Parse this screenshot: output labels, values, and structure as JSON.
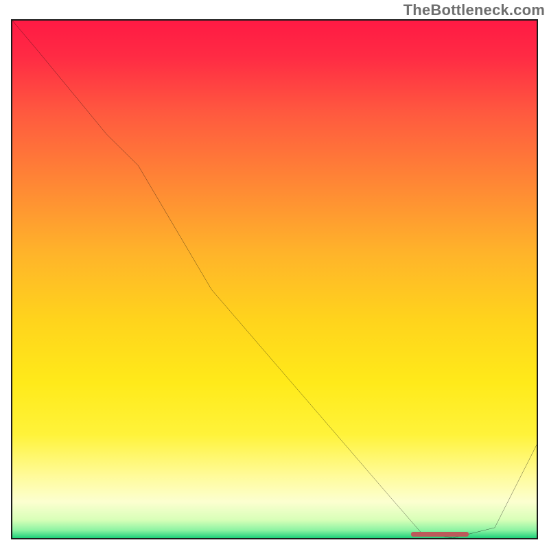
{
  "watermark": "TheBottleneck.com",
  "gradient_stops": [
    {
      "offset": 0.0,
      "color": "#ff1a44"
    },
    {
      "offset": 0.07,
      "color": "#ff2b44"
    },
    {
      "offset": 0.18,
      "color": "#ff5a3f"
    },
    {
      "offset": 0.3,
      "color": "#ff8236"
    },
    {
      "offset": 0.45,
      "color": "#ffb42a"
    },
    {
      "offset": 0.58,
      "color": "#ffd41c"
    },
    {
      "offset": 0.7,
      "color": "#ffea1a"
    },
    {
      "offset": 0.8,
      "color": "#fff33a"
    },
    {
      "offset": 0.88,
      "color": "#fffb9a"
    },
    {
      "offset": 0.93,
      "color": "#fcffd0"
    },
    {
      "offset": 0.965,
      "color": "#d8ffb8"
    },
    {
      "offset": 0.985,
      "color": "#8cf3a3"
    },
    {
      "offset": 1.0,
      "color": "#1fd07a"
    }
  ],
  "chart_data": {
    "type": "line",
    "title": "",
    "xlabel": "",
    "ylabel": "",
    "xlim": [
      0,
      100
    ],
    "ylim": [
      0,
      100
    ],
    "x": [
      0,
      5,
      18,
      24,
      38,
      55,
      72,
      78,
      84,
      92,
      100
    ],
    "values": [
      100,
      94,
      78,
      72,
      48,
      28,
      8,
      1,
      0,
      2,
      18
    ],
    "marker": {
      "x_start": 76,
      "x_end": 87,
      "y": 0.3
    },
    "annotations": []
  }
}
